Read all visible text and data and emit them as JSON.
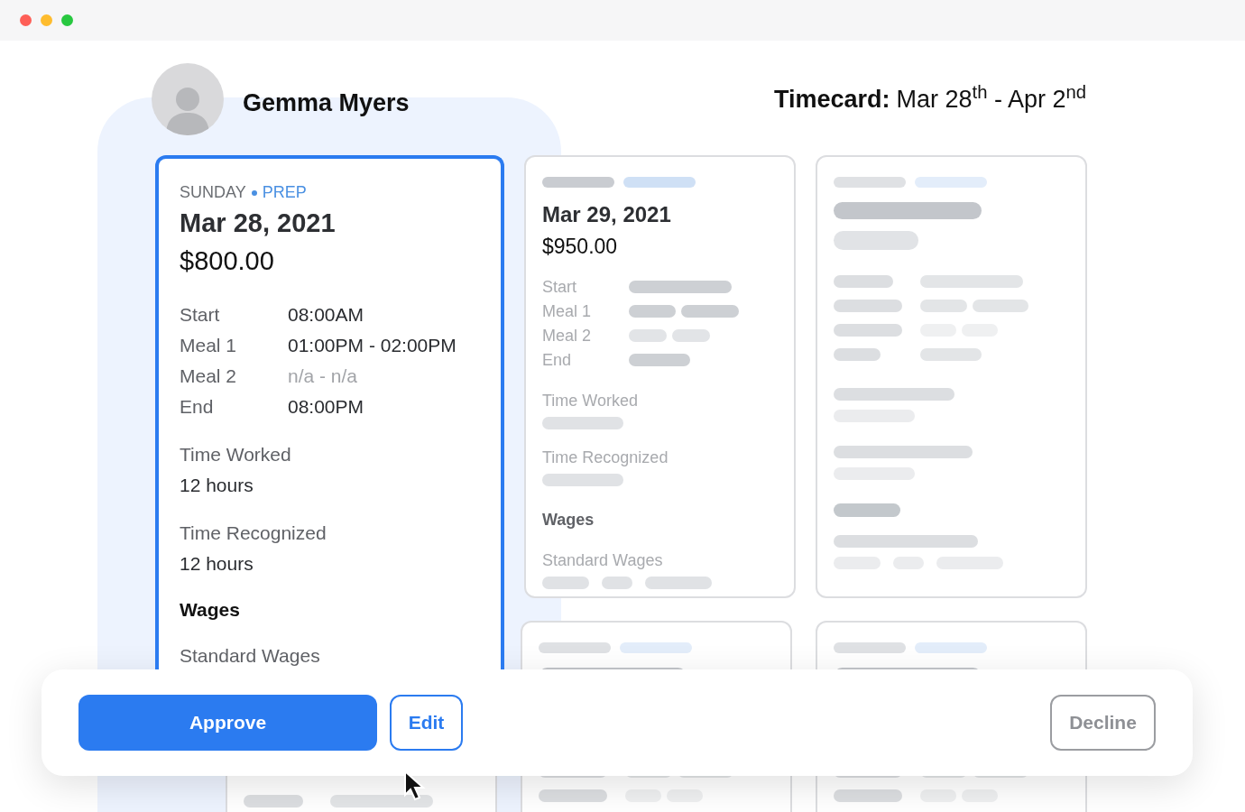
{
  "employee": {
    "name": "Gemma Myers"
  },
  "timecard": {
    "label": "Timecard:",
    "range": "Mar 28$^{th}$ - Apr 2$^{nd}$"
  },
  "cards": [
    {
      "kind": "full",
      "selected": true,
      "day": "SUNDAY",
      "tag": "PREP",
      "date": "Mar 28, 2021",
      "amount": "$800.00",
      "rows": [
        {
          "label": "Start",
          "value": "08:00AM",
          "muted": false
        },
        {
          "label": "Meal 1",
          "value": "01:00PM - 02:00PM",
          "muted": false
        },
        {
          "label": "Meal 2",
          "value": "n/a - n/a",
          "muted": true
        },
        {
          "label": "End",
          "value": "08:00PM",
          "muted": false
        }
      ],
      "sections": [
        {
          "label": "Time Worked",
          "value": "12 hours"
        },
        {
          "label": "Time Recognized",
          "value": "12 hours"
        }
      ],
      "wages_title": "Wages",
      "wages_label": "Standard Wages"
    },
    {
      "kind": "partial",
      "selected": false,
      "date": "Mar 29, 2021",
      "amount": "$950.00",
      "rows": [
        {
          "label": "Start"
        },
        {
          "label": "Meal 1"
        },
        {
          "label": "Meal 2"
        },
        {
          "label": "End"
        }
      ],
      "sections": [
        {
          "label": "Time Worked"
        },
        {
          "label": "Time Recognized"
        }
      ],
      "wages_title": "Wages",
      "wages_label": "Standard Wages"
    },
    {
      "kind": "skeleton",
      "selected": false
    },
    {
      "kind": "skeleton",
      "selected": false
    },
    {
      "kind": "skeleton",
      "selected": false
    },
    {
      "kind": "skeleton",
      "selected": false
    }
  ],
  "actions": [
    {
      "label": "Approve",
      "kind": "primary"
    },
    {
      "label": "Edit",
      "kind": "outline"
    },
    {
      "label": "Decline",
      "kind": "muted"
    }
  ]
}
